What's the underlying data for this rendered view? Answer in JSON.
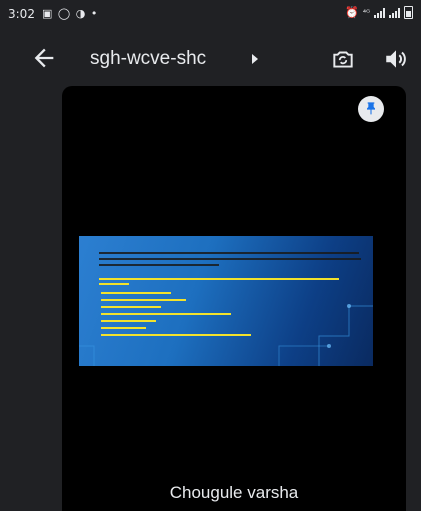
{
  "status_bar": {
    "time": "3:02",
    "notification_icons": [
      "image-icon",
      "whatsapp-icon",
      "chat-icon",
      "dot-icon"
    ],
    "right_icons": [
      "alarm-icon",
      "volte-icon",
      "signal-icon",
      "battery-icon"
    ]
  },
  "header": {
    "meeting_code": "sgh-wcve-shc",
    "icons": [
      "back-arrow-icon",
      "chevron-right-icon",
      "switch-camera-icon",
      "speaker-icon"
    ]
  },
  "participant": {
    "name": "Chougule varsha",
    "pin_icon": "pin-icon"
  },
  "colors": {
    "background": "#202124",
    "tile": "#000000",
    "slide_start": "#2c7fd1",
    "slide_end": "#0a2a60",
    "slide_text": "#f2e22c"
  }
}
